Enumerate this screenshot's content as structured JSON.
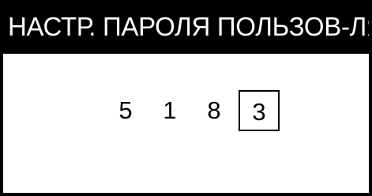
{
  "header": {
    "title": "НАСТР. ПАРОЛЯ ПОЛЬЗОВ-ЛЯ"
  },
  "password_entry": {
    "digits": [
      "5",
      "1",
      "8",
      "3"
    ],
    "selected_index": 3
  },
  "colors": {
    "title_bg": "#000000",
    "title_fg": "#ffffff",
    "screen_bg": "#ffffff"
  }
}
